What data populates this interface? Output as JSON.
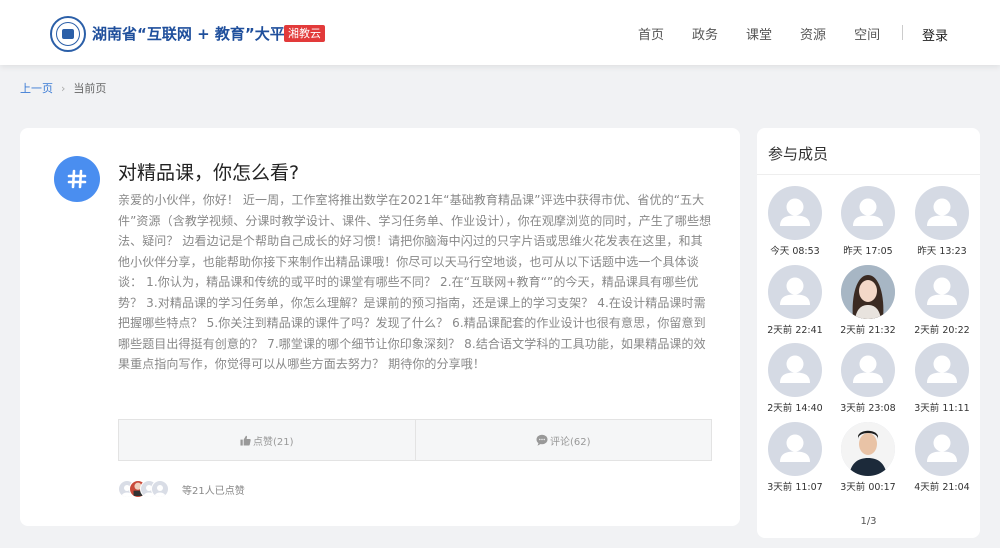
{
  "header": {
    "logo_text": "湖南省“互联网 + 教育”大平台",
    "logo_tag": "湘教云",
    "nav": [
      "首页",
      "政务",
      "课堂",
      "资源",
      "空间"
    ],
    "login_label": "登录"
  },
  "breadcrumb": {
    "prev": "上一页",
    "current": "当前页"
  },
  "topic": {
    "title": "对精品课，你怎么看?",
    "body": "亲爱的小伙伴，你好！ 近一周，工作室将推出数学在2021年“基础教育精品课”评选中获得市优、省优的“五大件”资源（含教学视频、分课时教学设计、课件、学习任务单、作业设计），你在观摩浏览的同时，产生了哪些想法、疑问？ 边看边记是个帮助自己成长的好习惯！请把你脑海中闪过的只字片语或思维火花发表在这里，和其他小伙伴分享，也能帮助你接下来制作出精品课哦！你尽可以天马行空地谈，也可从以下话题中选一个具体谈谈： 1.你认为，精品课和传统的或平时的课堂有哪些不同？ 2.在“互联网+教育“”的今天，精品课具有哪些优势？ 3.对精品课的学习任务单，你怎么理解？是课前的预习指南，还是课上的学习支架？ 4.在设计精品课时需把握哪些特点？ 5.你关注到精品课的课件了吗？发现了什么？ 6.精品课配套的作业设计也很有意思，你留意到哪些题目出得挺有创意的？ 7.哪堂课的哪个细节让你印象深刻？ 8.结合语文学科的工具功能，如果精品课的效果重点指向写作，你觉得可以从哪些方面去努力？ 期待你的分享哦！",
    "like_label": "点赞(21)",
    "comment_label": "评论(62)",
    "likers_text": "等21人已点赞"
  },
  "members_panel": {
    "title": "参与成员",
    "members": [
      {
        "time": "今天 08:53",
        "avatar": "default-avatar"
      },
      {
        "time": "昨天 17:05",
        "avatar": "default-avatar"
      },
      {
        "time": "昨天 13:23",
        "avatar": "default-avatar"
      },
      {
        "time": "2天前 22:41",
        "avatar": "default-avatar"
      },
      {
        "time": "2天前 21:32",
        "avatar": "photo-woman"
      },
      {
        "time": "2天前 20:22",
        "avatar": "default-avatar"
      },
      {
        "time": "2天前 14:40",
        "avatar": "default-avatar"
      },
      {
        "time": "3天前 23:08",
        "avatar": "default-avatar"
      },
      {
        "time": "3天前 11:11",
        "avatar": "default-avatar"
      },
      {
        "time": "3天前 11:07",
        "avatar": "default-avatar"
      },
      {
        "time": "3天前 00:17",
        "avatar": "photo-man"
      },
      {
        "time": "4天前 21:04",
        "avatar": "default-avatar"
      }
    ],
    "pager": "1/3"
  },
  "colors": {
    "brand_blue": "#1f4f9c",
    "tag_red": "#e23a3a",
    "topic_icon": "#4a8ef0",
    "link_blue": "#3a7bd5"
  }
}
